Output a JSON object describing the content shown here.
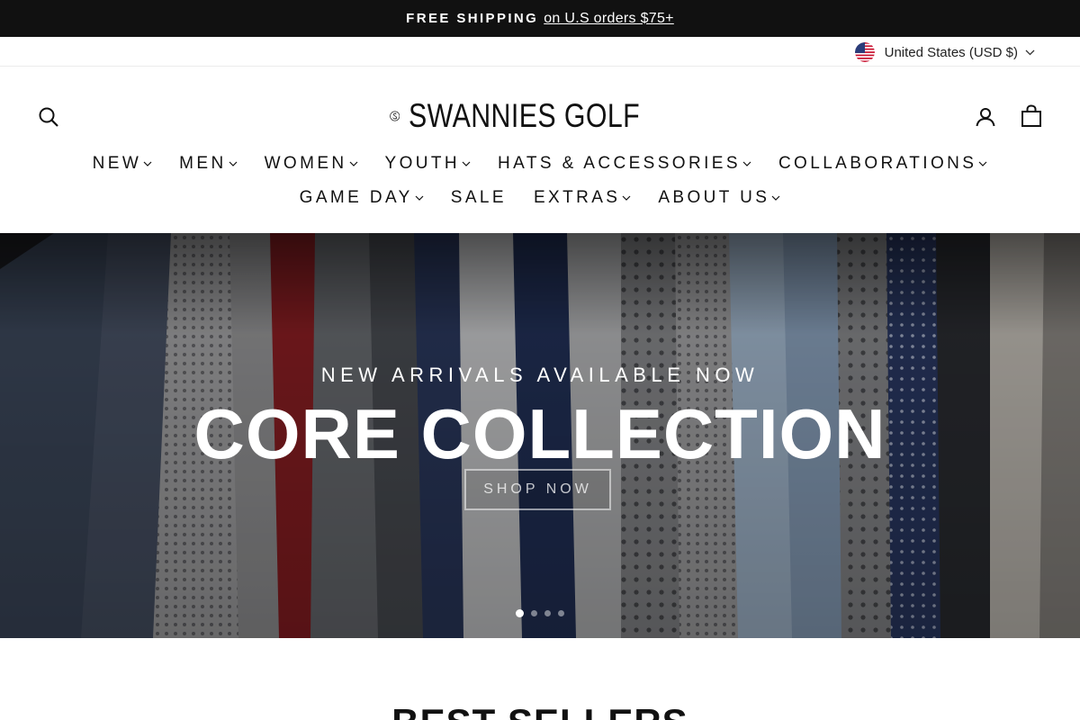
{
  "announcement": {
    "bold": "FREE SHIPPING",
    "link": "on U.S orders $75+"
  },
  "currency": {
    "label": "United States (USD $)",
    "flag_icon": "us-flag-icon"
  },
  "header": {
    "logo_text": "SWANNIES GOLF",
    "icons": {
      "search": "search-icon",
      "account": "user-icon",
      "cart": "bag-icon"
    }
  },
  "nav": {
    "row1": [
      {
        "label": "NEW",
        "dropdown": true
      },
      {
        "label": "MEN",
        "dropdown": true
      },
      {
        "label": "WOMEN",
        "dropdown": true
      },
      {
        "label": "YOUTH",
        "dropdown": true
      },
      {
        "label": "HATS & ACCESSORIES",
        "dropdown": true
      },
      {
        "label": "COLLABORATIONS",
        "dropdown": true
      }
    ],
    "row2": [
      {
        "label": "GAME DAY",
        "dropdown": true
      },
      {
        "label": "SALE",
        "dropdown": false
      },
      {
        "label": "EXTRAS",
        "dropdown": true
      },
      {
        "label": "ABOUT US",
        "dropdown": true
      }
    ]
  },
  "hero": {
    "subtitle": "NEW ARRIVALS AVAILABLE NOW",
    "title": "CORE COLLECTION",
    "button": "SHOP NOW",
    "slides": 4,
    "active_slide": 1
  },
  "section": {
    "title": "BEST SELLERS"
  },
  "colors": {
    "announcement_bg": "#111111",
    "text": "#111111",
    "background": "#ffffff"
  }
}
